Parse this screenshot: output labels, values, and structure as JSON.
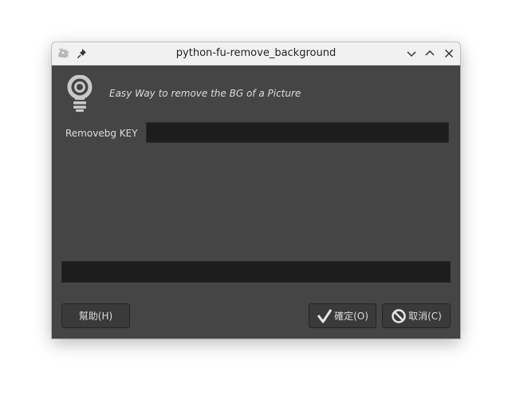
{
  "window": {
    "title": "python-fu-remove_background"
  },
  "titlebar": {
    "icons": [
      "gimp-app-icon",
      "pin-icon"
    ],
    "controls": [
      "minimize-icon",
      "maximize-icon",
      "close-icon"
    ]
  },
  "dialog": {
    "icon": "lightbulb-icon",
    "description": "Easy Way to remove the BG of a Picture",
    "key_label": "Removebg KEY",
    "key_value": "",
    "progress": 0
  },
  "buttons": {
    "help": "幫助(H)",
    "ok": "確定(O)",
    "cancel": "取消(C)"
  },
  "colors": {
    "background": "#454545",
    "field": "#1d1d1d",
    "titlebar": "#f1f1f1"
  }
}
